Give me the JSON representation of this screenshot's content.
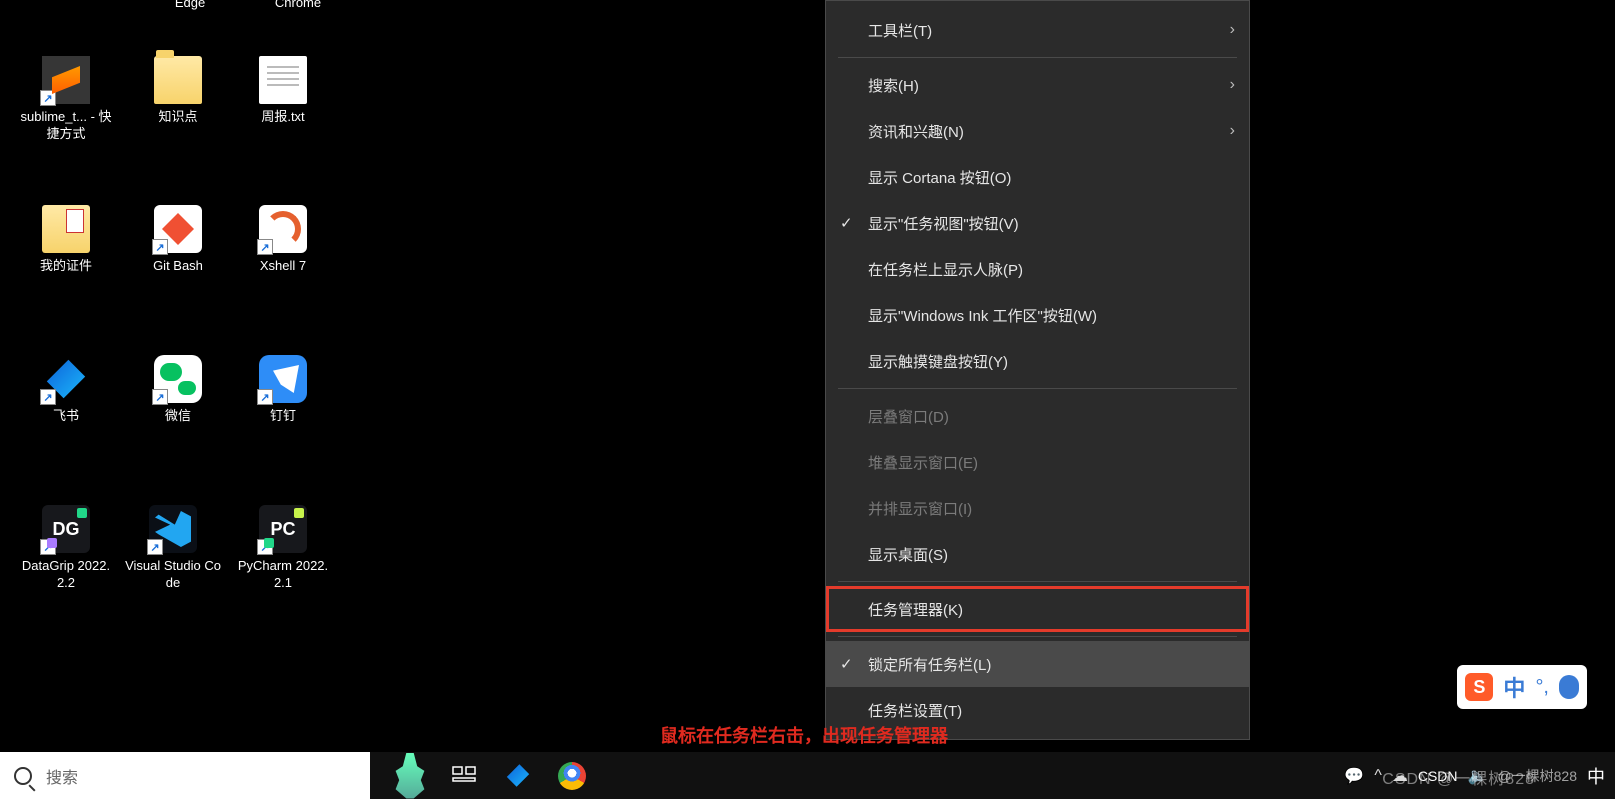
{
  "desktop": {
    "row0": [
      {
        "label": "Edge"
      },
      {
        "label": "Chrome"
      }
    ],
    "icons": [
      {
        "label": "sublime_t... - 快捷方式"
      },
      {
        "label": "知识点"
      },
      {
        "label": "周报.txt"
      },
      {
        "label": "我的证件"
      },
      {
        "label": "Git Bash"
      },
      {
        "label": "Xshell 7"
      },
      {
        "label": "飞书"
      },
      {
        "label": "微信"
      },
      {
        "label": "钉钉"
      },
      {
        "label": "DataGrip 2022.2.2"
      },
      {
        "label": "Visual Studio Code"
      },
      {
        "label": "PyCharm 2022.2.1"
      }
    ]
  },
  "context_menu": {
    "items": [
      {
        "label": "工具栏(T)",
        "submenu": true
      },
      {
        "divider": true
      },
      {
        "label": "搜索(H)",
        "submenu": true
      },
      {
        "label": "资讯和兴趣(N)",
        "submenu": true
      },
      {
        "label": "显示 Cortana 按钮(O)"
      },
      {
        "label": "显示\"任务视图\"按钮(V)",
        "checked": true
      },
      {
        "label": "在任务栏上显示人脉(P)"
      },
      {
        "label": "显示\"Windows Ink 工作区\"按钮(W)"
      },
      {
        "label": "显示触摸键盘按钮(Y)"
      },
      {
        "divider": true
      },
      {
        "label": "层叠窗口(D)",
        "disabled": true
      },
      {
        "label": "堆叠显示窗口(E)",
        "disabled": true
      },
      {
        "label": "并排显示窗口(I)",
        "disabled": true
      },
      {
        "label": "显示桌面(S)"
      },
      {
        "divider": true
      },
      {
        "label": "任务管理器(K)",
        "highlight": true
      },
      {
        "divider": true
      },
      {
        "label": "锁定所有任务栏(L)",
        "checked": true,
        "hover": true
      },
      {
        "label": "任务栏设置(T)"
      }
    ]
  },
  "taskbar": {
    "search_placeholder": "搜索"
  },
  "tray": {
    "items": [
      "^",
      "☁",
      "🔈",
      "📶"
    ],
    "wechat": "●",
    "csdn": "CSDN",
    "user": "@一棵树828",
    "zh": "中"
  },
  "ime": {
    "sogou": "S",
    "zh": "中"
  },
  "annotation": "鼠标在任务栏右击，出现任务管理器",
  "watermark": "CSDN @一棵树828"
}
